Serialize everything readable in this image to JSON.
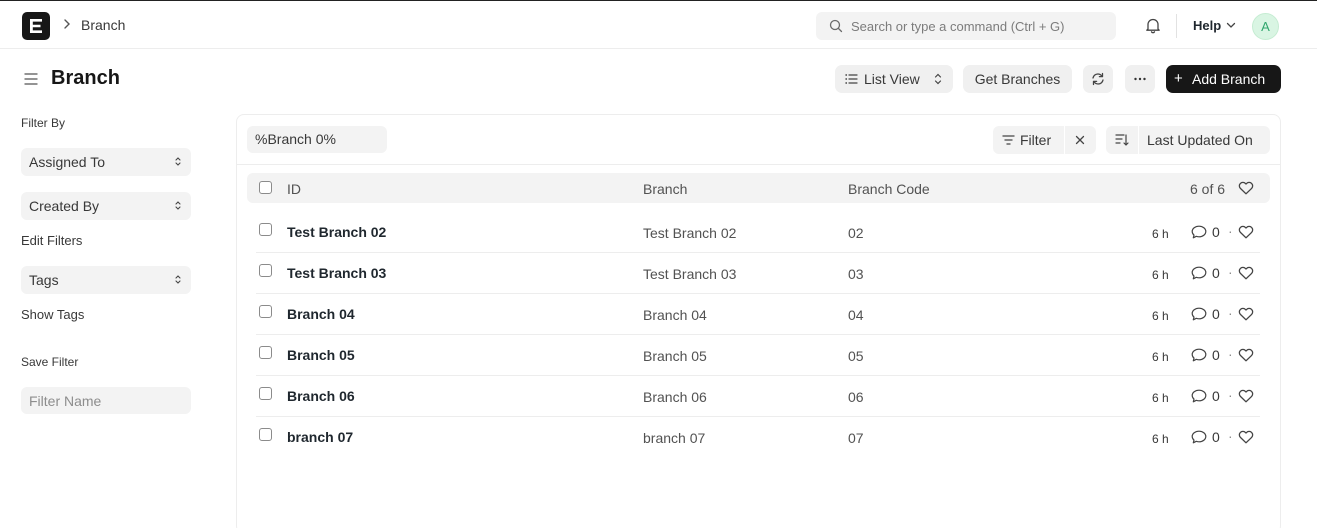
{
  "navbar": {
    "logo_letter": "E",
    "breadcrumb": "Branch",
    "search_placeholder": "Search or type a command (Ctrl + G)",
    "help_label": "Help",
    "avatar_initial": "A"
  },
  "page": {
    "title": "Branch",
    "list_view_label": "List View",
    "get_branches_label": "Get Branches",
    "add_label": "Add Branch",
    "primary_color": "#171717"
  },
  "sidebar": {
    "filter_by_label": "Filter By",
    "assigned_to": "Assigned To",
    "created_by": "Created By",
    "edit_filters": "Edit Filters",
    "tags": "Tags",
    "show_tags": "Show Tags",
    "save_filter_label": "Save Filter",
    "filter_name_placeholder": "Filter Name"
  },
  "toolbar": {
    "standard_filter_value": "%Branch 0%",
    "filter_label": "Filter",
    "sort_label": "Last Updated On"
  },
  "list": {
    "columns": [
      "ID",
      "Branch",
      "Branch Code"
    ],
    "count": "6 of 6",
    "rows": [
      {
        "id": "Test Branch 02",
        "branch": "Test Branch 02",
        "code": "02",
        "time": "6 h",
        "comments": "0"
      },
      {
        "id": "Test Branch 03",
        "branch": "Test Branch 03",
        "code": "03",
        "time": "6 h",
        "comments": "0"
      },
      {
        "id": "Branch 04",
        "branch": "Branch 04",
        "code": "04",
        "time": "6 h",
        "comments": "0"
      },
      {
        "id": "Branch 05",
        "branch": "Branch 05",
        "code": "05",
        "time": "6 h",
        "comments": "0"
      },
      {
        "id": "Branch 06",
        "branch": "Branch 06",
        "code": "06",
        "time": "6 h",
        "comments": "0"
      },
      {
        "id": "branch 07",
        "branch": "branch 07",
        "code": "07",
        "time": "6 h",
        "comments": "0"
      }
    ]
  }
}
